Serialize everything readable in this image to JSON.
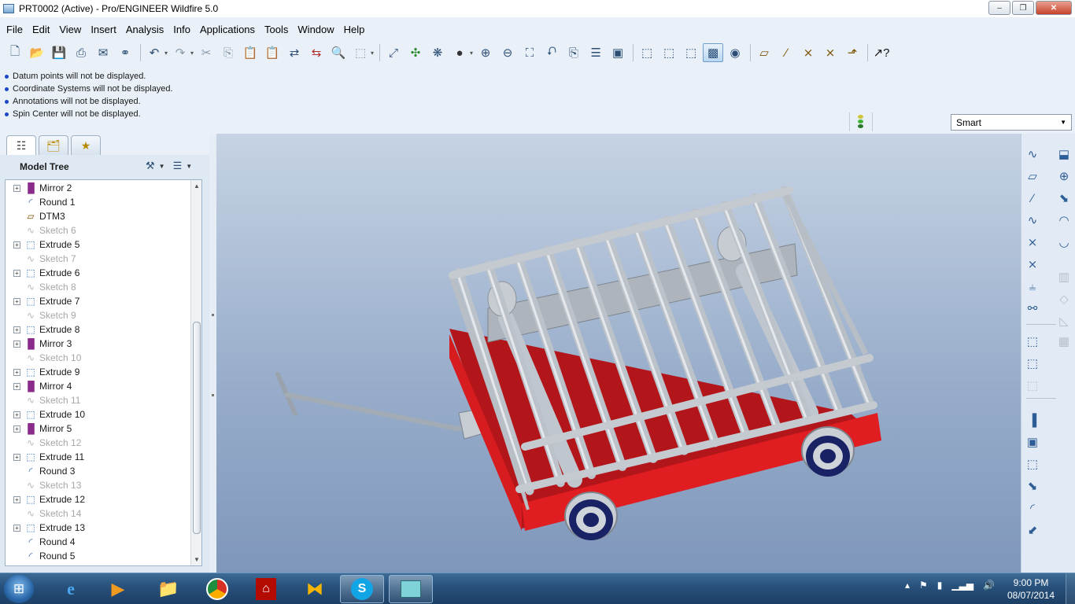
{
  "window": {
    "title": "PRT0002 (Active) - Pro/ENGINEER Wildfire 5.0",
    "min_label": "–",
    "max_label": "❐",
    "close_label": "✕"
  },
  "menu": [
    "File",
    "Edit",
    "View",
    "Insert",
    "Analysis",
    "Info",
    "Applications",
    "Tools",
    "Window",
    "Help"
  ],
  "messages": [
    "Datum points will not be displayed.",
    "Coordinate Systems will not be displayed.",
    "Annotations will not be displayed.",
    "Spin Center will not be displayed."
  ],
  "filter": {
    "value": "Smart"
  },
  "model_tree": {
    "title": "Model Tree",
    "items": [
      {
        "label": "Mirror 2",
        "type": "mirror",
        "expandable": true,
        "dim": false
      },
      {
        "label": "Round 1",
        "type": "round",
        "expandable": false,
        "dim": false
      },
      {
        "label": "DTM3",
        "type": "datum",
        "expandable": false,
        "dim": false
      },
      {
        "label": "Sketch 6",
        "type": "sketch",
        "expandable": false,
        "dim": true
      },
      {
        "label": "Extrude 5",
        "type": "extrude",
        "expandable": true,
        "dim": false
      },
      {
        "label": "Sketch 7",
        "type": "sketch",
        "expandable": false,
        "dim": true
      },
      {
        "label": "Extrude 6",
        "type": "extrude",
        "expandable": true,
        "dim": false
      },
      {
        "label": "Sketch 8",
        "type": "sketch",
        "expandable": false,
        "dim": true
      },
      {
        "label": "Extrude 7",
        "type": "extrude",
        "expandable": true,
        "dim": false
      },
      {
        "label": "Sketch 9",
        "type": "sketch",
        "expandable": false,
        "dim": true
      },
      {
        "label": "Extrude 8",
        "type": "extrude",
        "expandable": true,
        "dim": false
      },
      {
        "label": "Mirror 3",
        "type": "mirror",
        "expandable": true,
        "dim": false
      },
      {
        "label": "Sketch 10",
        "type": "sketch",
        "expandable": false,
        "dim": true
      },
      {
        "label": "Extrude 9",
        "type": "extrude",
        "expandable": true,
        "dim": false
      },
      {
        "label": "Mirror 4",
        "type": "mirror",
        "expandable": true,
        "dim": false
      },
      {
        "label": "Sketch 11",
        "type": "sketch",
        "expandable": false,
        "dim": true
      },
      {
        "label": "Extrude 10",
        "type": "extrude",
        "expandable": true,
        "dim": false
      },
      {
        "label": "Mirror 5",
        "type": "mirror",
        "expandable": true,
        "dim": false
      },
      {
        "label": "Sketch 12",
        "type": "sketch",
        "expandable": false,
        "dim": true
      },
      {
        "label": "Extrude 11",
        "type": "extrude",
        "expandable": true,
        "dim": false
      },
      {
        "label": "Round 3",
        "type": "round",
        "expandable": false,
        "dim": false
      },
      {
        "label": "Sketch 13",
        "type": "sketch",
        "expandable": false,
        "dim": true
      },
      {
        "label": "Extrude 12",
        "type": "extrude",
        "expandable": true,
        "dim": false
      },
      {
        "label": "Sketch 14",
        "type": "sketch",
        "expandable": false,
        "dim": true
      },
      {
        "label": "Extrude 13",
        "type": "extrude",
        "expandable": true,
        "dim": false
      },
      {
        "label": "Round 4",
        "type": "round",
        "expandable": false,
        "dim": false
      },
      {
        "label": "Round 5",
        "type": "round",
        "expandable": false,
        "dim": false
      }
    ]
  },
  "icons": {
    "mirror": "▐▌",
    "round": "◜",
    "datum": "▱",
    "sketch": "∿",
    "extrude": "⬚"
  },
  "colors": {
    "viewport_top": "#c6d3e4",
    "viewport_bottom": "#7f97bb",
    "cart_base": "#d8191b",
    "frame": "#c9cdd3",
    "tire": "#1a2266"
  },
  "clock": {
    "time": "9:00 PM",
    "date": "08/07/2014"
  }
}
